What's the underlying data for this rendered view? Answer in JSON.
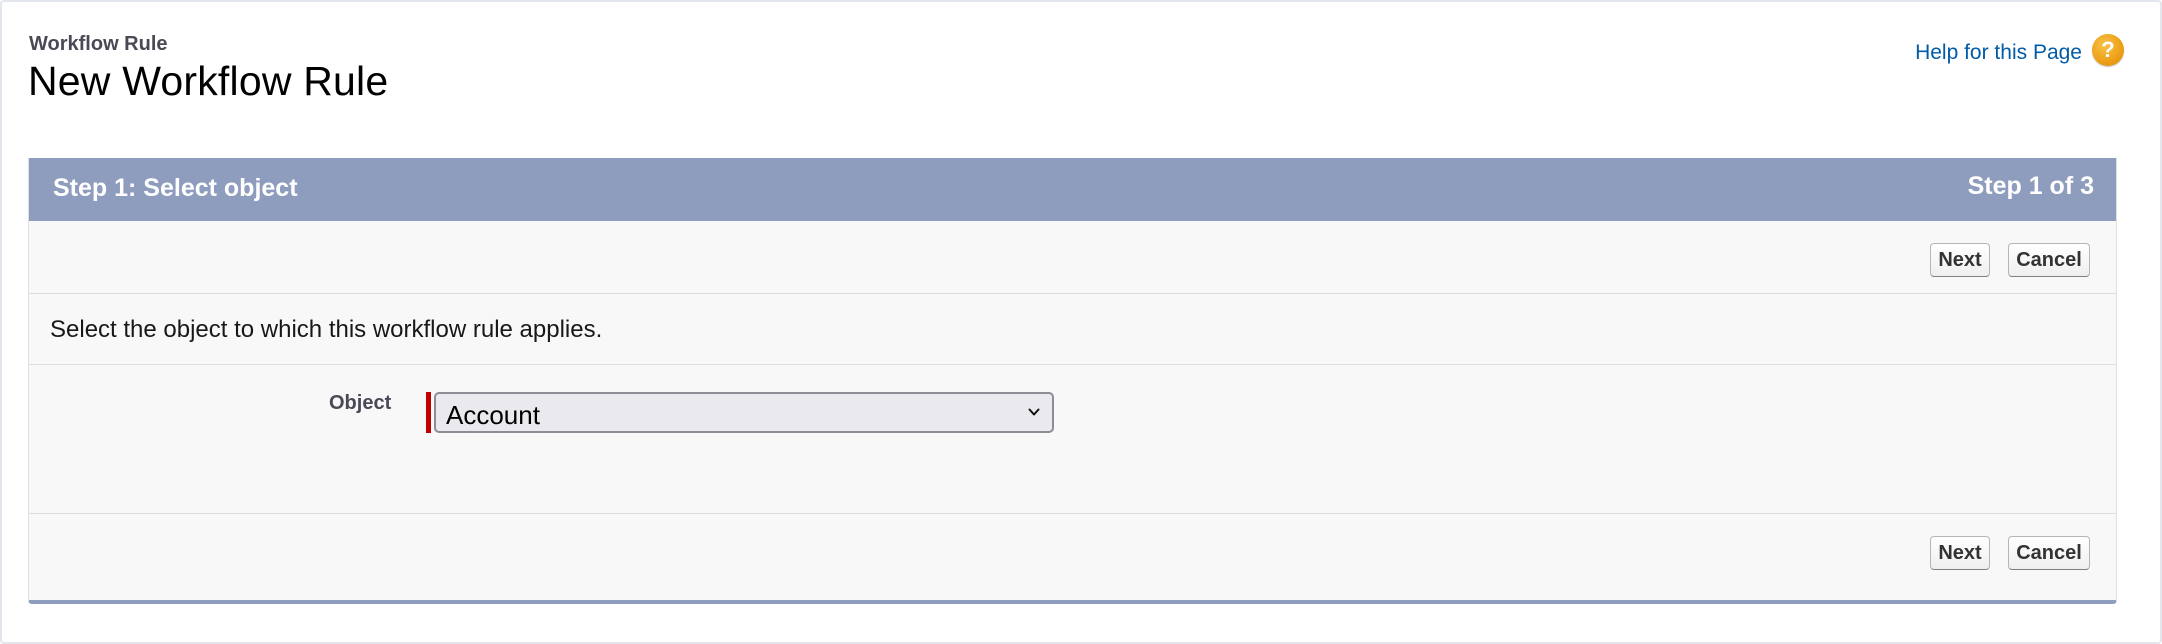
{
  "header": {
    "breadcrumb": "Workflow Rule",
    "title": "New Workflow Rule",
    "help_link": "Help for this Page",
    "help_icon": "question-icon"
  },
  "panel": {
    "step_title": "Step 1: Select object",
    "step_count": "Step 1 of 3",
    "buttons": {
      "next": "Next",
      "cancel": "Cancel"
    },
    "instruction": "Select the object to which this workflow rule applies.",
    "object_field": {
      "label": "Object",
      "selected": "Account",
      "required": true
    }
  },
  "colors": {
    "header_bar": "#8e9dbe",
    "help_link": "#015ba7",
    "required_marker": "#c00000",
    "help_icon": "#eea21a"
  }
}
